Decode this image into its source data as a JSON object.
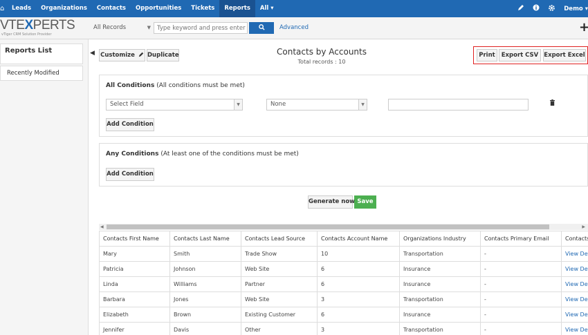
{
  "nav": {
    "home_glyph": "⌂",
    "items": [
      "Leads",
      "Organizations",
      "Contacts",
      "Opportunities",
      "Tickets",
      "Reports",
      "All ▾"
    ],
    "active": "Reports",
    "user": "Demo ▾"
  },
  "logo": {
    "prefix": "VTE",
    "mark": "X",
    "suffix": "PERTS",
    "tagline": "vTiger CRM Solution Provider"
  },
  "search": {
    "records_label": "All Records",
    "placeholder": "Type keyword and press enter",
    "button_label": "Q",
    "advanced_label": "Advanced"
  },
  "sidebar": {
    "list_title": "Reports List",
    "recent": "Recently Modified"
  },
  "toolbar": {
    "customize_label": "Customize",
    "duplicate_label": "Duplicate"
  },
  "report": {
    "title": "Contacts by Accounts",
    "total_records": "Total records : 10"
  },
  "export": {
    "print_label": "Print",
    "csv_label": "Export CSV",
    "excel_label": "Export Excel"
  },
  "all_conditions": {
    "title": "All Conditions",
    "subtitle": "(All conditions must be met)",
    "field_value": "Select Field",
    "operator_value": "None",
    "add_label": "Add Condition"
  },
  "any_conditions": {
    "title": "Any Conditions",
    "subtitle": "(At least one of the conditions must be met)",
    "add_label": "Add Condition"
  },
  "actions": {
    "generate_label": "Generate now",
    "save_label": "Save"
  },
  "table": {
    "headers": [
      "Contacts First Name",
      "Contacts Last Name",
      "Contacts Lead Source",
      "Contacts Account Name",
      "Organizations Industry",
      "Contacts Primary Email",
      "Contacts"
    ],
    "rows": [
      [
        "Mary",
        "Smith",
        "Trade Show",
        "10",
        "Transportation",
        "-",
        "View Det"
      ],
      [
        "Patricia",
        "Johnson",
        "Web Site",
        "6",
        "Insurance",
        "-",
        "View Det"
      ],
      [
        "Linda",
        "Williams",
        "Partner",
        "6",
        "Insurance",
        "-",
        "View Det"
      ],
      [
        "Barbara",
        "Jones",
        "Web Site",
        "3",
        "Transportation",
        "-",
        "View Det"
      ],
      [
        "Elizabeth",
        "Brown",
        "Existing Customer",
        "6",
        "Insurance",
        "-",
        "View Det"
      ],
      [
        "Jennifer",
        "Davis",
        "Other",
        "3",
        "Transportation",
        "-",
        "View Det"
      ]
    ]
  },
  "colors": {
    "nav_bg": "#2069b3",
    "save_green": "#4caf50",
    "highlight_red": "#e02020"
  }
}
